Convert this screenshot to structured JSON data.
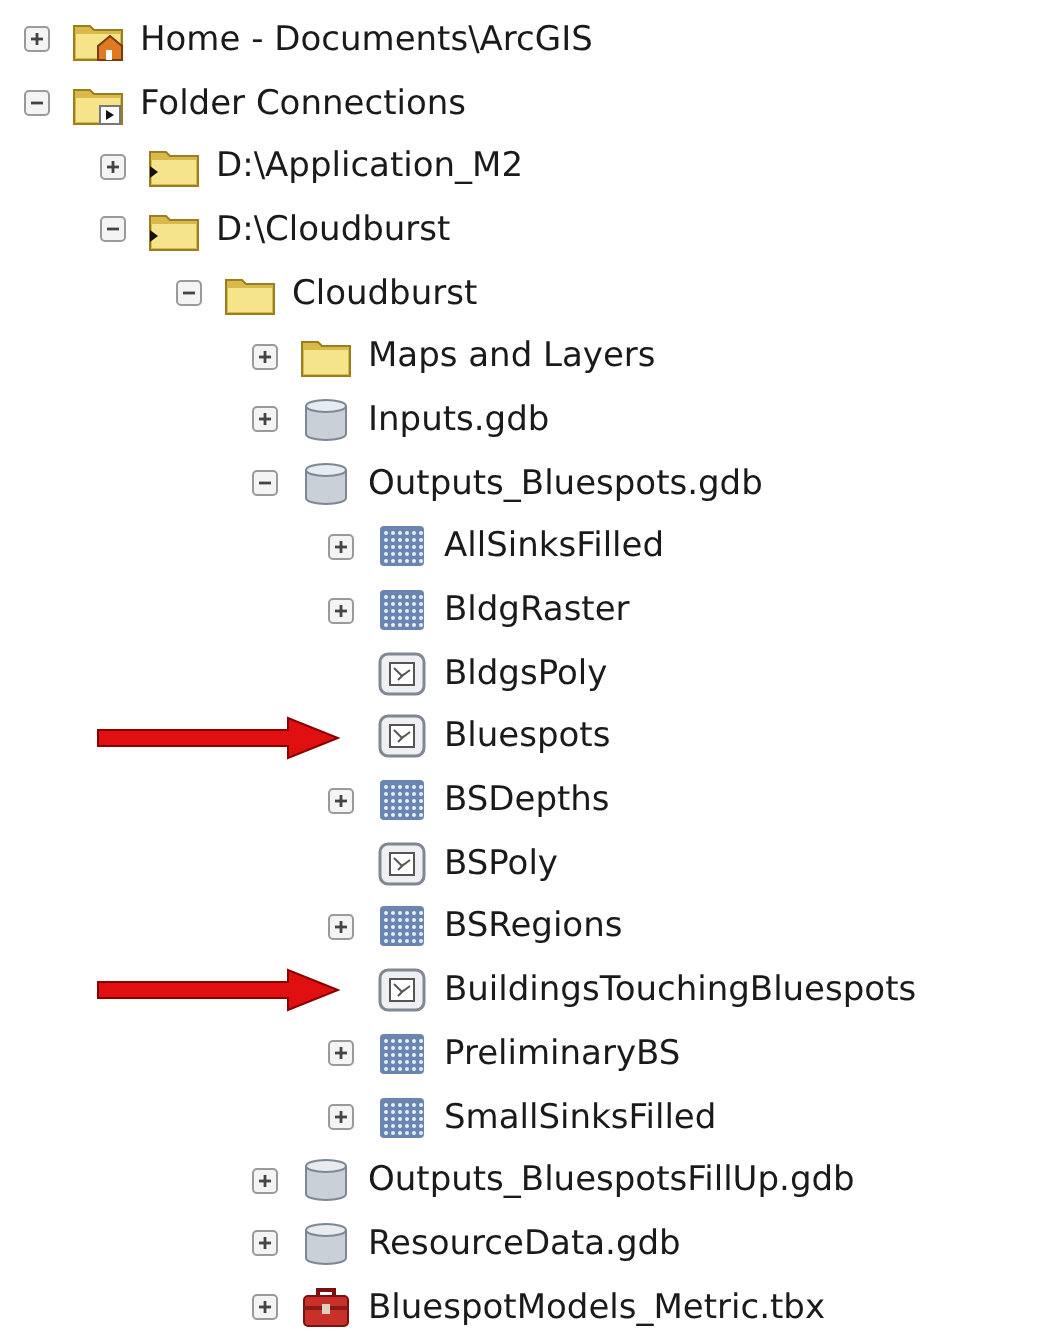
{
  "tree": [
    {
      "label": "Home - Documents\\ArcGIS",
      "kind": "home",
      "expanded": false
    },
    {
      "label": "Folder Connections",
      "kind": "connections",
      "expanded": true,
      "children": [
        {
          "label": "D:\\Application_M2",
          "kind": "connection",
          "expanded": false
        },
        {
          "label": "D:\\Cloudburst",
          "kind": "connection",
          "expanded": true,
          "children": [
            {
              "label": "Cloudburst",
              "kind": "folder",
              "expanded": true,
              "children": [
                {
                  "label": "Maps and Layers",
                  "kind": "folder",
                  "expanded": false
                },
                {
                  "label": "Inputs.gdb",
                  "kind": "gdb",
                  "expanded": false
                },
                {
                  "label": "Outputs_Bluespots.gdb",
                  "kind": "gdb",
                  "expanded": true,
                  "children": [
                    {
                      "label": "AllSinksFilled",
                      "kind": "raster",
                      "expanded": false
                    },
                    {
                      "label": "BldgRaster",
                      "kind": "raster",
                      "expanded": false
                    },
                    {
                      "label": "BldgsPoly",
                      "kind": "polygon",
                      "pointed": false
                    },
                    {
                      "label": "Bluespots",
                      "kind": "polygon",
                      "pointed": true
                    },
                    {
                      "label": "BSDepths",
                      "kind": "raster",
                      "expanded": false
                    },
                    {
                      "label": "BSPoly",
                      "kind": "polygon",
                      "pointed": false
                    },
                    {
                      "label": "BSRegions",
                      "kind": "raster",
                      "expanded": false
                    },
                    {
                      "label": "BuildingsTouchingBluespots",
                      "kind": "polygon",
                      "pointed": true
                    },
                    {
                      "label": "PreliminaryBS",
                      "kind": "raster",
                      "expanded": false
                    },
                    {
                      "label": "SmallSinksFilled",
                      "kind": "raster",
                      "expanded": false
                    }
                  ]
                },
                {
                  "label": "Outputs_BluespotsFillUp.gdb",
                  "kind": "gdb",
                  "expanded": false
                },
                {
                  "label": "ResourceData.gdb",
                  "kind": "gdb",
                  "expanded": false
                },
                {
                  "label": "BluespotModels_Metric.tbx",
                  "kind": "toolbox",
                  "expanded": false
                }
              ]
            }
          ]
        }
      ]
    }
  ]
}
